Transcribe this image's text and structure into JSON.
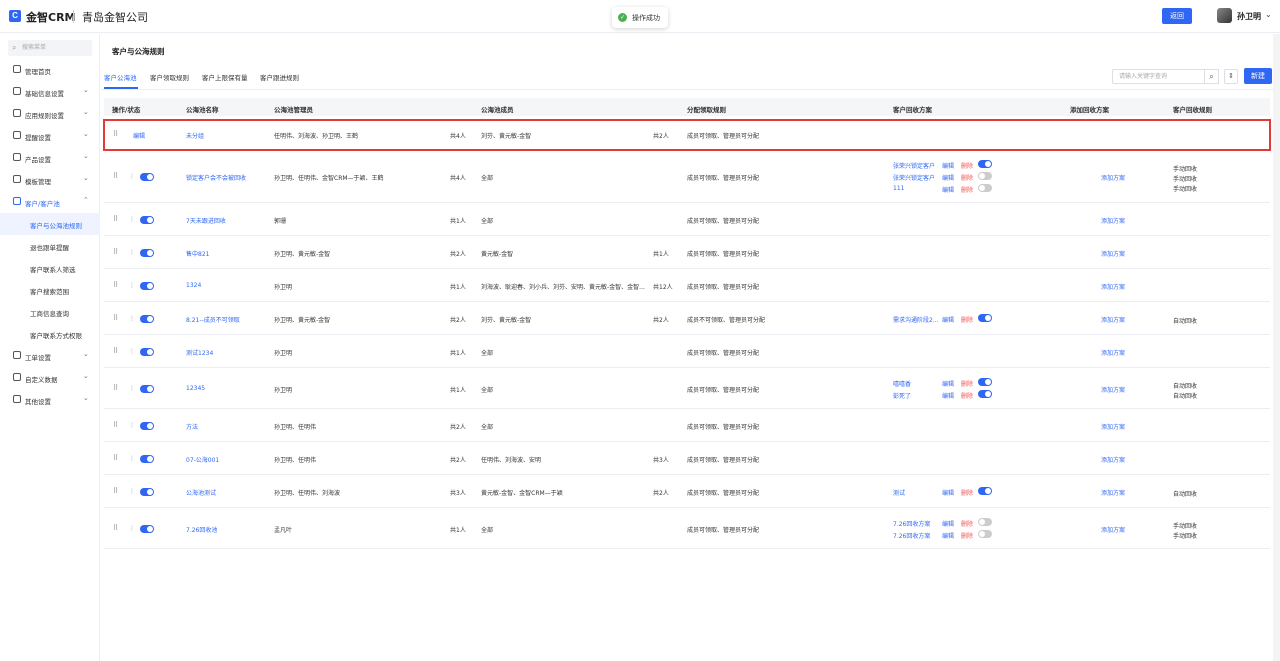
{
  "header": {
    "logo_text": "金智CRM",
    "company": "青岛金智公司",
    "toast": "操作成功",
    "back": "返回",
    "user": "孙卫明"
  },
  "sidebar": {
    "search_placeholder": "搜索菜单",
    "menu": [
      {
        "label": "管理首页",
        "caret": ""
      },
      {
        "label": "基础信息设置",
        "caret": "⌄"
      },
      {
        "label": "应用规则设置",
        "caret": "⌄"
      },
      {
        "label": "提醒设置",
        "caret": "⌄"
      },
      {
        "label": "产品设置",
        "caret": "⌄"
      },
      {
        "label": "模板管理",
        "caret": "⌄"
      },
      {
        "label": "客户/客户池",
        "caret": "⌃"
      }
    ],
    "sub": [
      "客户与公海池规则",
      "退也跟单提醒",
      "客户联系人筛选",
      "客户搜索范围",
      "工商信息查询",
      "客户联系方式权限"
    ],
    "menu2": [
      {
        "label": "工单设置",
        "caret": "⌄"
      },
      {
        "label": "自定义数据",
        "caret": "⌄"
      },
      {
        "label": "其他设置",
        "caret": "⌄"
      }
    ]
  },
  "main": {
    "title": "客户与公海规则",
    "tabs": [
      "客户公海池",
      "客户领取规则",
      "客户上限保有量",
      "客户跟进规则"
    ],
    "keyword_placeholder": "请输入关键字查询",
    "new_btn": "新建",
    "headers": [
      "操作/状态",
      "公海池名称",
      "公海池管理员",
      "公海池成员",
      "分配领取规则",
      "客户回收方案",
      "添加回收方案",
      "客户回收规则"
    ],
    "edit": "编辑",
    "del": "删除",
    "add_plan": "添加方案"
  },
  "rows": [
    {
      "name": "未分组",
      "admins": "任明伟、刘海波、孙卫明、王鹤",
      "admin_count": "共4人",
      "members": "刘芬、黄元敏-金智",
      "member_count": "共2人",
      "rule": "成员可领取、管理员可分配",
      "plans": [],
      "recycle": []
    },
    {
      "name": "锁定客户会不会被回收",
      "admins": "孙卫明、任明伟、金智CRM—于颖、王鹤",
      "admin_count": "共4人",
      "members": "全部",
      "member_count": "",
      "rule": "成员可领取、管理员可分配",
      "plans": [
        {
          "name": "张荣兴锁定客户",
          "on": true
        },
        {
          "name": "张荣兴锁定客户",
          "on": false
        },
        {
          "name": "111",
          "on": false
        }
      ],
      "recycle": [
        "手动回收",
        "手动回收",
        "手动回收"
      ]
    },
    {
      "name": "7天未跟进回收",
      "admins": "郭珊",
      "admin_count": "共1人",
      "members": "全部",
      "member_count": "",
      "rule": "成员可领取、管理员可分配",
      "plans": [],
      "recycle": []
    },
    {
      "name": "售中821",
      "admins": "孙卫明、黄元敏-金智",
      "admin_count": "共2人",
      "members": "黄元敏-金智",
      "member_count": "共1人",
      "rule": "成员可领取、管理员可分配",
      "plans": [],
      "recycle": []
    },
    {
      "name": "1324",
      "admins": "孙卫明",
      "admin_count": "共1人",
      "members": "刘海波、耿迎春、刘小兵、刘芬、安明、黄元敏-金智、金智...",
      "member_count": "共12人",
      "rule": "成员可领取、管理员可分配",
      "plans": [],
      "recycle": []
    },
    {
      "name": "8.21--成员不可领取",
      "admins": "孙卫明、黄元敏-金智",
      "admin_count": "共2人",
      "members": "刘芬、黄元敏-金智",
      "member_count": "共2人",
      "rule": "成员不可领取、管理员可分配",
      "plans": [
        {
          "name": "需求沟通阶段2...",
          "on": true
        }
      ],
      "recycle": [
        "自动回收"
      ]
    },
    {
      "name": "测试1234",
      "admins": "孙卫明",
      "admin_count": "共1人",
      "members": "全部",
      "member_count": "",
      "rule": "成员可领取、管理员可分配",
      "plans": [],
      "recycle": []
    },
    {
      "name": "12345",
      "admins": "孙卫明",
      "admin_count": "共1人",
      "members": "全部",
      "member_count": "",
      "rule": "成员可领取、管理员可分配",
      "plans": [
        {
          "name": "嘻嘻香",
          "on": true
        },
        {
          "name": "彭死了",
          "on": true
        }
      ],
      "recycle": [
        "自动回收",
        "自动回收"
      ]
    },
    {
      "name": "方法",
      "admins": "孙卫明、任明伟",
      "admin_count": "共2人",
      "members": "全部",
      "member_count": "",
      "rule": "成员可领取、管理员可分配",
      "plans": [],
      "recycle": []
    },
    {
      "name": "07-公海001",
      "admins": "孙卫明、任明伟",
      "admin_count": "共2人",
      "members": "任明伟、刘海波、安明",
      "member_count": "共3人",
      "rule": "成员可领取、管理员可分配",
      "plans": [],
      "recycle": []
    },
    {
      "name": "公海池测试",
      "admins": "孙卫明、任明伟、刘海波",
      "admin_count": "共3人",
      "members": "黄元敏-金智、金智CRM—于颖",
      "member_count": "共2人",
      "rule": "成员可领取、管理员可分配",
      "plans": [
        {
          "name": "测试",
          "on": true
        }
      ],
      "recycle": [
        "自动回收"
      ]
    },
    {
      "name": "7.26回收池",
      "admins": "孟凡叶",
      "admin_count": "共1人",
      "members": "全部",
      "member_count": "",
      "rule": "成员可领取、管理员可分配",
      "plans": [
        {
          "name": "7.26回收方案",
          "on": false
        },
        {
          "name": "7.26回收方案",
          "on": false
        }
      ],
      "recycle": [
        "手动回收",
        "手动回收"
      ]
    }
  ]
}
